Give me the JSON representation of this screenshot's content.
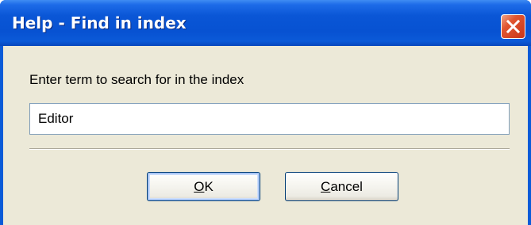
{
  "window": {
    "title": "Help - Find in index"
  },
  "dialog": {
    "prompt": "Enter term to search for in the index",
    "search_value": "Editor"
  },
  "buttons": {
    "ok": {
      "mnemonic": "O",
      "rest": "K"
    },
    "cancel": {
      "mnemonic": "C",
      "rest": "ancel"
    }
  },
  "colors": {
    "titlebar_blue": "#0a56d6",
    "client_bg": "#ece9d8",
    "close_red": "#e0552f",
    "input_border": "#7f9db9",
    "button_border": "#003c74"
  },
  "icons": {
    "close": "close-icon"
  }
}
